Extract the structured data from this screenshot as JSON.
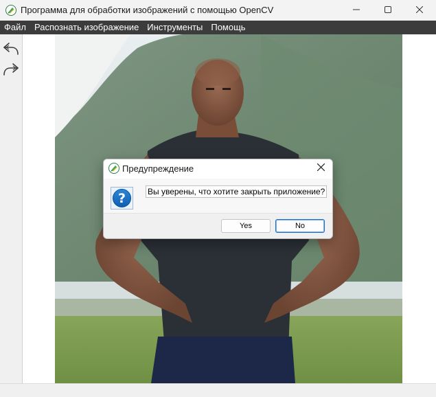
{
  "window": {
    "title": "Программа для обработки изображений с помощью OpenCV",
    "icon": "app-logo-icon",
    "controls": [
      "minimize-icon",
      "maximize-icon",
      "close-icon"
    ]
  },
  "menu": {
    "items": [
      {
        "label": "Файл"
      },
      {
        "label": "Распознать изображение"
      },
      {
        "label": "Инструменты"
      },
      {
        "label": "Помощь"
      }
    ]
  },
  "toolbar": {
    "tools": [
      {
        "icon": "undo-icon"
      },
      {
        "icon": "redo-icon"
      }
    ]
  },
  "canvas": {
    "image": "photo of muscular man in dark t-shirt with hands on hips, mountains in background"
  },
  "dialog": {
    "title": "Предупреждение",
    "icon": "question-icon",
    "message": "Вы уверены, что хотите закрыть приложение?",
    "buttons": {
      "yes_label": "Yes",
      "no_label": "No"
    }
  },
  "colors": {
    "menubar_bg": "#3c3c3c",
    "titlebar_bg": "#f3f3f3",
    "accent": "#1a6fd0"
  }
}
